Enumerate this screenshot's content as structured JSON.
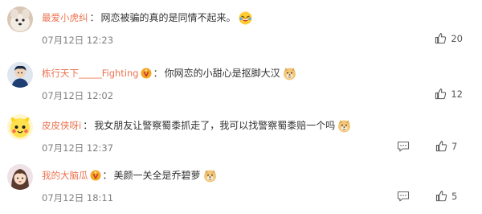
{
  "comments": [
    {
      "username": "最爱小虎纠",
      "has_badge": false,
      "colon": "：",
      "text": "网恋被骗的真的是同情不起来。",
      "emoji": "laughing-tears-emoji",
      "time": "07月12日 12:23",
      "likes": "20",
      "show_reply": false
    },
    {
      "username": "栋行天下_____Fighting",
      "has_badge": true,
      "colon": "：",
      "text": "你网恋的小甜心是抠脚大汉",
      "emoji": "doge-emoji",
      "time": "07月12日 12:02",
      "likes": "12",
      "show_reply": false
    },
    {
      "username": "皮皮侠呀i",
      "has_badge": false,
      "colon": "：",
      "text": "我女朋友让警察蜀黍抓走了，我可以找警察蜀黍赔一个吗",
      "emoji": "doge-emoji",
      "time": "07月12日 12:37",
      "likes": "7",
      "show_reply": true
    },
    {
      "username": "我的大脑瓜",
      "has_badge": true,
      "colon": "：",
      "text": "美颜一关全是乔碧萝",
      "emoji": "doge-emoji",
      "time": "07月12日 18:11",
      "likes": "5",
      "show_reply": true
    }
  ],
  "colors": {
    "username": "#eb7350",
    "time": "#808080",
    "text": "#333333"
  }
}
